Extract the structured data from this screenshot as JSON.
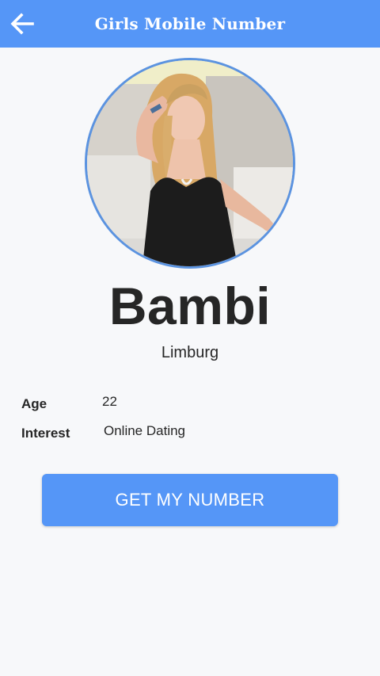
{
  "app_bar": {
    "title": "Girls Mobile Number",
    "back_icon": "arrow-left-icon",
    "background": "#5596f7"
  },
  "profile": {
    "name": "Bambi",
    "location": "Limburg",
    "photo_icon": "profile-photo"
  },
  "details": {
    "age_label": "Age",
    "age_value": "22",
    "interest_label": "Interest",
    "interest_value": "Online Dating"
  },
  "action": {
    "button_label": "GET MY NUMBER",
    "accent": "#5596f7"
  }
}
